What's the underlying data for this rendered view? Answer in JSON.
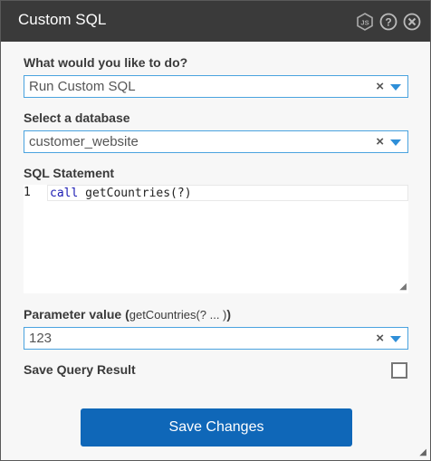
{
  "dialog": {
    "title": "Custom SQL",
    "icons": [
      "js-badge-icon",
      "help-icon",
      "close-icon"
    ]
  },
  "action": {
    "label": "What would you like to do?",
    "value": "Run Custom SQL",
    "clear": "×"
  },
  "database": {
    "label": "Select a database",
    "value": "customer_website",
    "clear": "×"
  },
  "sql": {
    "label": "SQL Statement",
    "line_number": "1",
    "keyword": "call",
    "rest": " getCountries(?)"
  },
  "parameter": {
    "label": "Parameter value (",
    "sub": "getCountries(? ... )",
    "suffix": ")",
    "value": "123",
    "clear": "×"
  },
  "save_result": {
    "label": "Save Query Result",
    "checked": false
  },
  "footer": {
    "save_label": "Save Changes"
  },
  "colors": {
    "titlebar": "#3a3a3a",
    "accent": "#0f67b8",
    "focus_border": "#4aa3df"
  }
}
